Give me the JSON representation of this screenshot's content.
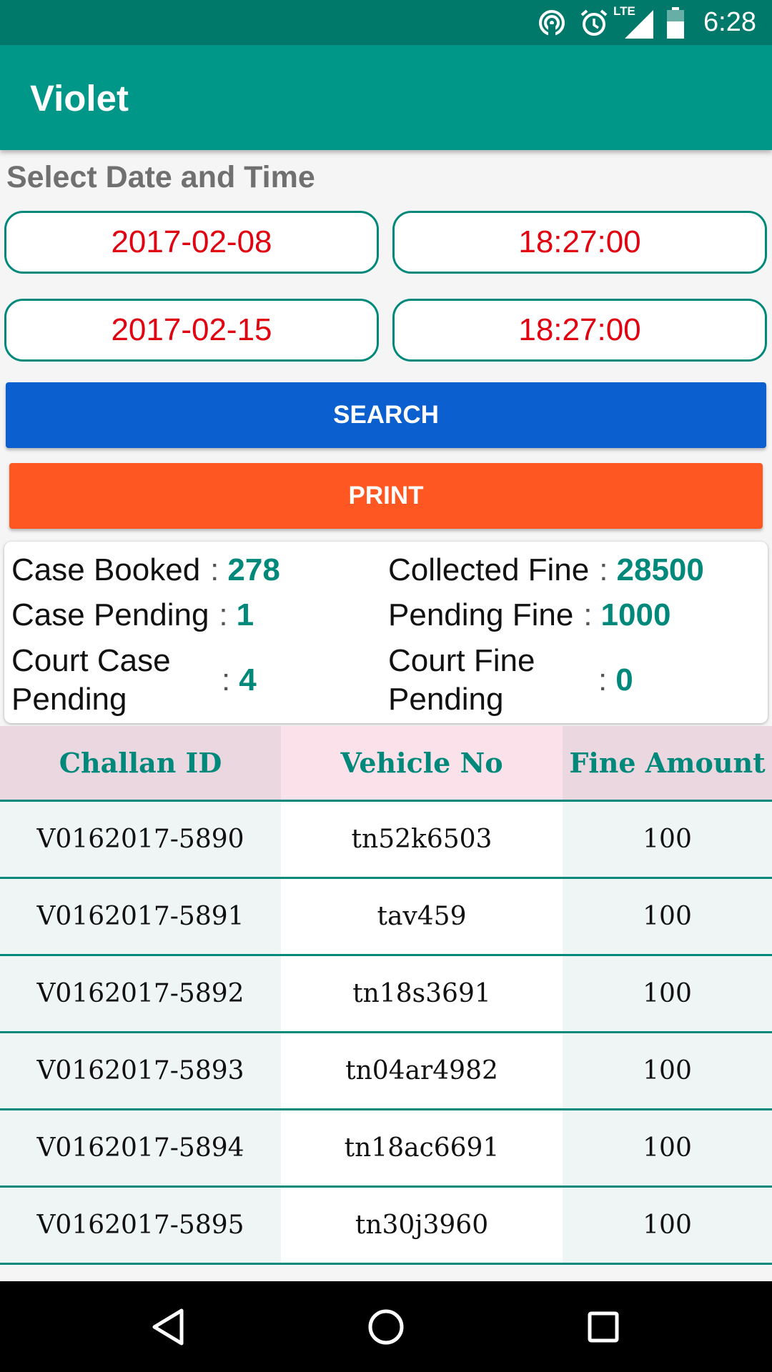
{
  "status_bar": {
    "time": "6:28",
    "network": "LTE",
    "icons": [
      "hotspot-icon",
      "alarm-icon",
      "signal-icon",
      "battery-icon"
    ]
  },
  "app_bar": {
    "title": "Violet"
  },
  "date_section": {
    "label": "Select Date and Time",
    "from_date": "2017-02-08",
    "from_time": "18:27:00",
    "to_date": "2017-02-15",
    "to_time": "18:27:00"
  },
  "buttons": {
    "search": "SEARCH",
    "print": "PRINT"
  },
  "summary": {
    "case_booked": {
      "label": "Case Booked",
      "value": "278"
    },
    "collected_fine": {
      "label": "Collected Fine",
      "value": "28500"
    },
    "case_pending": {
      "label": "Case Pending",
      "value": "1"
    },
    "pending_fine": {
      "label": "Pending Fine",
      "value": "1000"
    },
    "court_case_pending": {
      "label": "Court Case Pending",
      "value": "4"
    },
    "court_fine_pending": {
      "label": "Court Fine Pending",
      "value": "0"
    },
    "colon": ":"
  },
  "table": {
    "headers": [
      "Challan ID",
      "Vehicle No",
      "Fine Amount"
    ],
    "rows": [
      [
        "V0162017-5890",
        "tn52k6503",
        "100"
      ],
      [
        "V0162017-5891",
        "tav459",
        "100"
      ],
      [
        "V0162017-5892",
        "tn18s3691",
        "100"
      ],
      [
        "V0162017-5893",
        "tn04ar4982",
        "100"
      ],
      [
        "V0162017-5894",
        "tn18ac6691",
        "100"
      ],
      [
        "V0162017-5895",
        "tn30j3960",
        "100"
      ]
    ]
  },
  "colors": {
    "primary": "#009688",
    "status": "#00796b",
    "search": "#0b5fce",
    "print": "#ff5722",
    "date_text": "#e00010",
    "value": "#00897b"
  }
}
